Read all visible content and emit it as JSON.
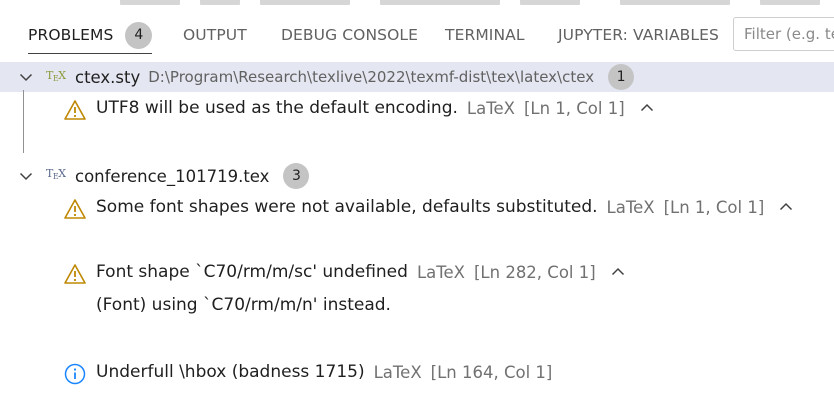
{
  "tabs": [
    {
      "label": "PROBLEMS",
      "badge": "4"
    },
    {
      "label": "OUTPUT"
    },
    {
      "label": "DEBUG CONSOLE"
    },
    {
      "label": "TERMINAL"
    },
    {
      "label": "JUPYTER: VARIABLES"
    }
  ],
  "filter": {
    "placeholder": "Filter (e.g. text, **/*.ts, !**/node_modules/**)"
  },
  "files": [
    {
      "name": "ctex.sty",
      "path": "D:\\Program\\Research\\texlive\\2022\\texmf-dist\\tex\\latex\\ctex",
      "count": "1",
      "icon_label": "TEX",
      "problems": [
        {
          "severity": "warning",
          "message": "UTF8 will be used as the default encoding.",
          "source": "LaTeX",
          "location": "[Ln 1, Col 1]"
        }
      ]
    },
    {
      "name": "conference_101719.tex",
      "count": "3",
      "icon_label": "TEX",
      "problems": [
        {
          "severity": "warning",
          "message": "Some font shapes were not available, defaults substituted.",
          "source": "LaTeX",
          "location": "[Ln 1, Col 1]"
        },
        {
          "severity": "warning",
          "message": "Font shape `C70/rm/m/sc' undefined",
          "source": "LaTeX",
          "location": "[Ln 282, Col 1]",
          "detail": "(Font) using `C70/rm/m/n' instead."
        },
        {
          "severity": "info",
          "message": "Underfull \\hbox (badness 1715)",
          "source": "LaTeX",
          "location": "[Ln 164, Col 1]"
        }
      ]
    }
  ],
  "colors": {
    "warning": "#bf8803",
    "info": "#1a85ff",
    "tex_icon_1": "#8a9a3a",
    "tex_icon_2": "#5a6a8c",
    "selection": "#e4e6f1"
  }
}
